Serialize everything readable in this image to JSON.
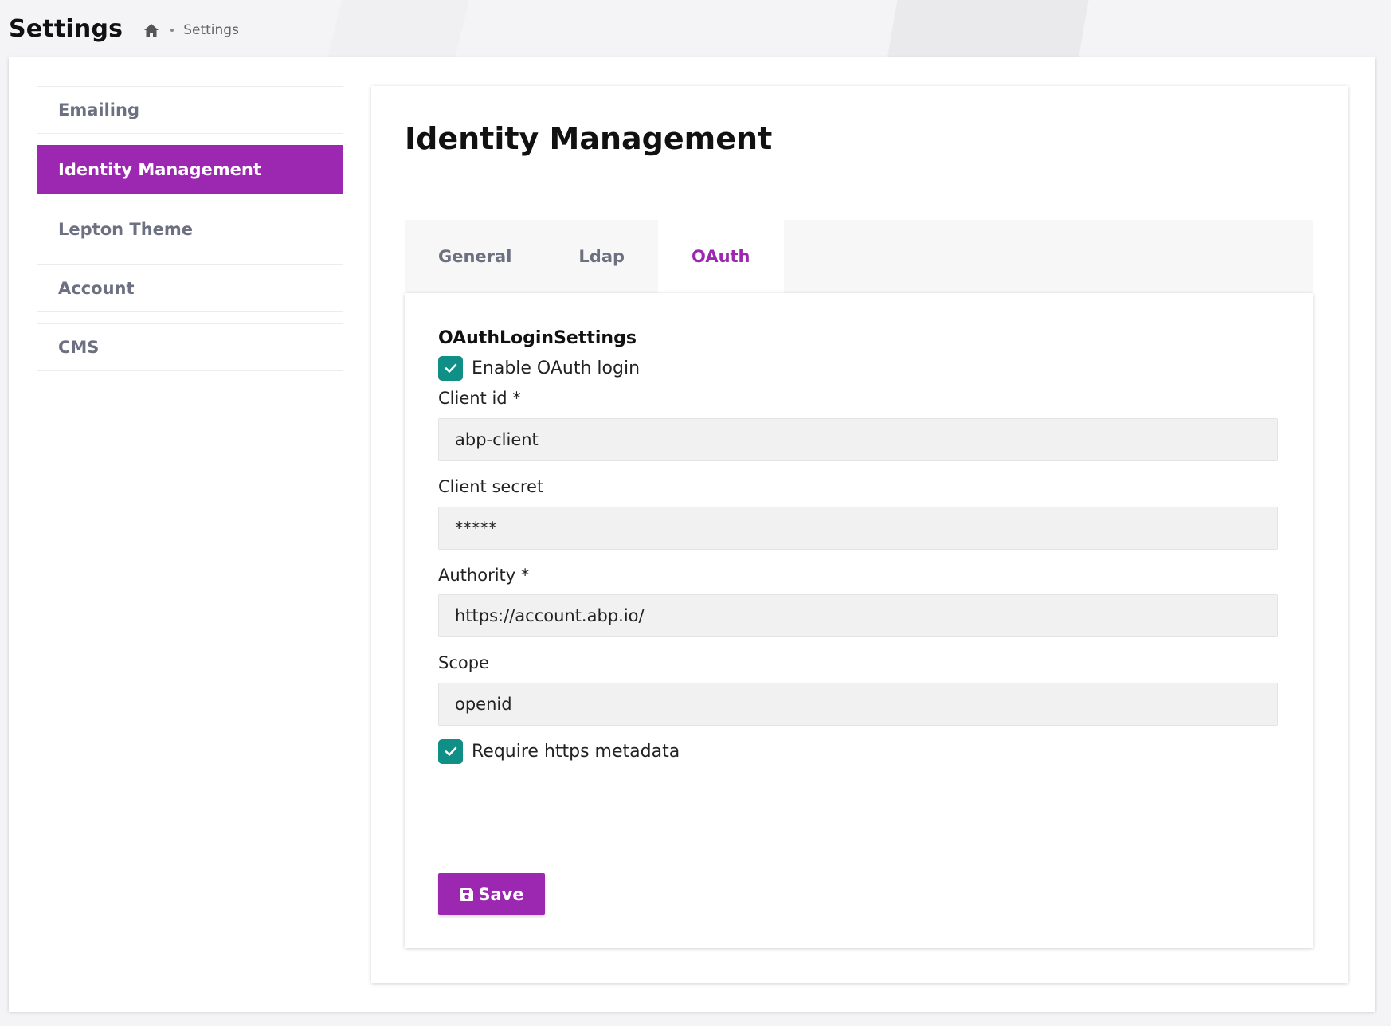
{
  "header": {
    "title": "Settings",
    "breadcrumb": {
      "home_icon": "home-icon",
      "current": "Settings"
    }
  },
  "nav": {
    "items": [
      {
        "label": "Emailing",
        "active": false
      },
      {
        "label": "Identity Management",
        "active": true
      },
      {
        "label": "Lepton Theme",
        "active": false
      },
      {
        "label": "Account",
        "active": false
      },
      {
        "label": "CMS",
        "active": false
      }
    ]
  },
  "section": {
    "title": "Identity Management",
    "tabs": [
      {
        "label": "General",
        "active": false
      },
      {
        "label": "Ldap",
        "active": false
      },
      {
        "label": "OAuth",
        "active": true
      }
    ]
  },
  "oauth": {
    "heading": "OAuthLoginSettings",
    "enable_login": {
      "label": "Enable OAuth login",
      "checked": true
    },
    "client_id": {
      "label": "Client id *",
      "value": "abp-client"
    },
    "client_secret": {
      "label": "Client secret",
      "value": "*****"
    },
    "authority": {
      "label": "Authority *",
      "value": "https://account.abp.io/"
    },
    "scope": {
      "label": "Scope",
      "value": "openid"
    },
    "require_https": {
      "label": "Require https metadata",
      "checked": true
    },
    "save_label": "Save",
    "save_icon": "floppy-disk-icon"
  },
  "colors": {
    "accent": "#9c27b0",
    "checkbox": "#0f8f86",
    "nav_text": "#6c7080"
  }
}
